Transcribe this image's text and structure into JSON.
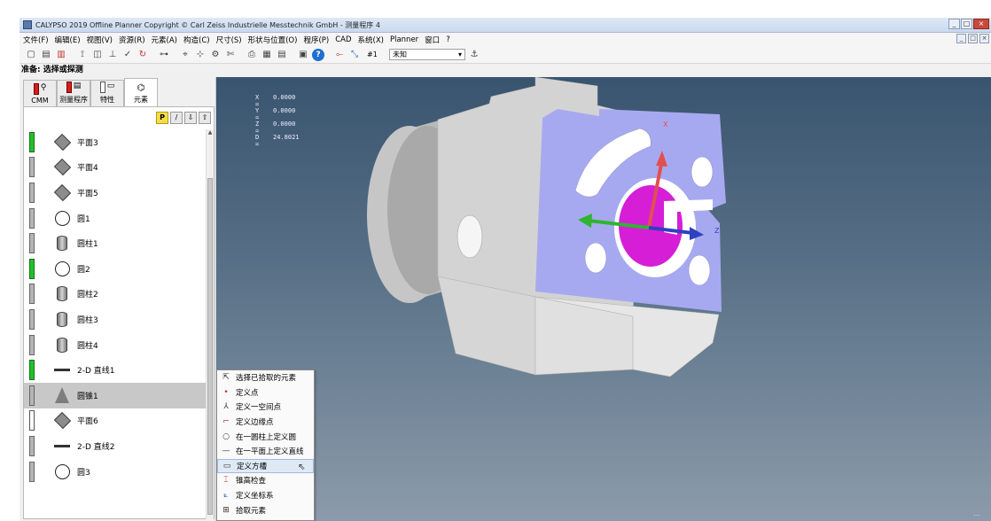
{
  "window": {
    "title": "CALYPSO 2019 Offline Planner Copyright © Carl Zeiss Industrielle Messtechnik GmbH - 测量程序 4",
    "buttons": [
      "_",
      "□",
      "×"
    ]
  },
  "menu": [
    "文件(F)",
    "编辑(E)",
    "视图(V)",
    "资源(R)",
    "元素(A)",
    "构造(C)",
    "尺寸(S)",
    "形状与位置(O)",
    "程序(P)",
    "CAD",
    "系统(X)",
    "Planner",
    "窗口",
    "?"
  ],
  "toolbar": {
    "coord_system": "#1",
    "select_value": "未知",
    "select_arrow": "▾"
  },
  "status_text": "准备: 选择或探测",
  "tabs": [
    {
      "label": "CMM",
      "active": false
    },
    {
      "label": "测量程序",
      "active": false
    },
    {
      "label": "特性",
      "active": false
    },
    {
      "label": "元素",
      "active": true
    }
  ],
  "panel_buttons": [
    "P",
    "/",
    "⇩",
    "⇧"
  ],
  "features": [
    {
      "label": "平面3",
      "icon": "plane",
      "status": "green"
    },
    {
      "label": "平面4",
      "icon": "plane",
      "status": "grey"
    },
    {
      "label": "平面5",
      "icon": "plane",
      "status": "grey"
    },
    {
      "label": "圆1",
      "icon": "circle",
      "status": "grey"
    },
    {
      "label": "圆柱1",
      "icon": "cylinder",
      "status": "grey"
    },
    {
      "label": "圆2",
      "icon": "circle",
      "status": "green"
    },
    {
      "label": "圆柱2",
      "icon": "cylinder",
      "status": "grey"
    },
    {
      "label": "圆柱3",
      "icon": "cylinder",
      "status": "grey"
    },
    {
      "label": "圆柱4",
      "icon": "cylinder",
      "status": "grey"
    },
    {
      "label": "2-D 直线1",
      "icon": "line",
      "status": "green"
    },
    {
      "label": "圆锥1",
      "icon": "cone",
      "status": "grey",
      "selected": true
    },
    {
      "label": "平面6",
      "icon": "plane",
      "status": "white"
    },
    {
      "label": "2-D 直线2",
      "icon": "line",
      "status": "grey"
    },
    {
      "label": "圆3",
      "icon": "circle",
      "status": "grey"
    }
  ],
  "coords": [
    {
      "k": "X =",
      "v": "0.0000"
    },
    {
      "k": "Y =",
      "v": "0.0000"
    },
    {
      "k": "Z =",
      "v": "0.0000"
    },
    {
      "k": "D =",
      "v": "24.8021"
    }
  ],
  "axis_labels": {
    "x": "X",
    "z": "Z"
  },
  "context_menu": [
    {
      "label": "选择已拾取的元素",
      "icon": "pick-icon"
    },
    {
      "label": "定义点",
      "icon": "point-icon"
    },
    {
      "label": "定义一空间点",
      "icon": "space-point-icon"
    },
    {
      "label": "定义边缘点",
      "icon": "edge-point-icon"
    },
    {
      "label": "在一圆柱上定义圆",
      "icon": "circle-on-cylinder-icon"
    },
    {
      "label": "在一平面上定义直线",
      "icon": "line-on-plane-icon"
    },
    {
      "label": "定义方槽",
      "icon": "slot-icon",
      "highlighted": true
    },
    {
      "label": "锥高检查",
      "icon": "cone-height-icon"
    },
    {
      "label": "定义坐标系",
      "icon": "coord-system-icon"
    },
    {
      "label": "拾取元素",
      "icon": "pick-element-icon"
    }
  ],
  "colors": {
    "viewport_top": "#39546f",
    "viewport_bottom": "#8c9bab",
    "part_grey": "#d0d0d0",
    "face_selected": "#a7a9f0",
    "cone_magenta": "#d51ed5",
    "status_green": "#22c02a",
    "status_red": "#d61f1f"
  }
}
